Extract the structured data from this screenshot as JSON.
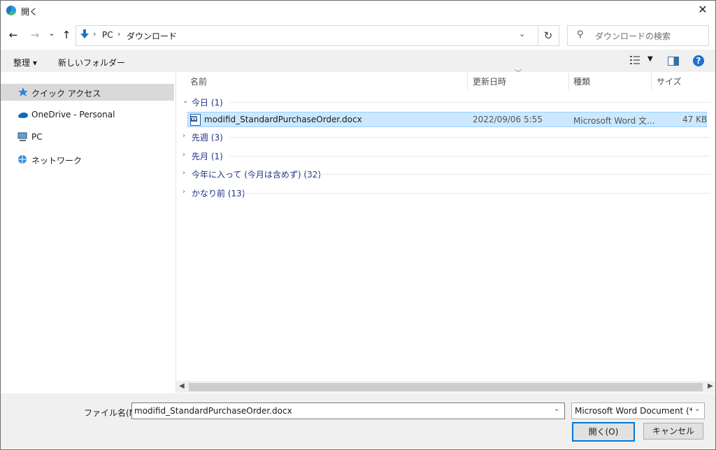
{
  "window": {
    "title": "開く",
    "close_glyph": "✕"
  },
  "nav": {
    "back_glyph": "←",
    "forward_glyph": "→",
    "recent_glyph": "⌄",
    "up_glyph": "↑",
    "breadcrumb": [
      "PC",
      "ダウンロード"
    ],
    "refresh_glyph": "↻",
    "search_placeholder": "ダウンロードの検索"
  },
  "toolbar": {
    "organize": "整理 ▾",
    "new_folder": "新しいフォルダー"
  },
  "sidebar": {
    "items": [
      {
        "label": "クイック アクセス",
        "icon": "star-icon"
      },
      {
        "label": "OneDrive - Personal",
        "icon": "cloud-icon"
      },
      {
        "label": "PC",
        "icon": "pc-icon"
      },
      {
        "label": "ネットワーク",
        "icon": "network-icon"
      }
    ]
  },
  "columns": {
    "name": "名前",
    "modified": "更新日時",
    "type": "種類",
    "size": "サイズ"
  },
  "groups": [
    {
      "label": "今日 (1)",
      "expanded": true
    },
    {
      "label": "先週 (3)",
      "expanded": false
    },
    {
      "label": "先月 (1)",
      "expanded": false
    },
    {
      "label": "今年に入って (今月は含めず) (32)",
      "expanded": false
    },
    {
      "label": "かなり前 (13)",
      "expanded": false
    }
  ],
  "file": {
    "name": "modifid_StandardPurchaseOrder.docx",
    "modified": "2022/09/06 5:55",
    "type": "Microsoft Word 文...",
    "size": "47 KB",
    "icon": "word-doc-icon"
  },
  "bottom": {
    "filename_label": "ファイル名(N):",
    "filename_value": "modifid_StandardPurchaseOrder.docx",
    "filetype_value": "Microsoft Word Document (*.docx)",
    "open_label": "開く(O)",
    "cancel_label": "キャンセル"
  },
  "colors": {
    "accent": "#0078d7",
    "selection": "#cce8ff",
    "group_text": "#1e3287"
  }
}
